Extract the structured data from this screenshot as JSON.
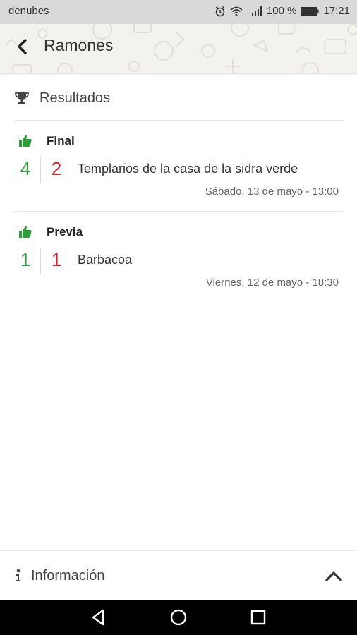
{
  "status_bar": {
    "carrier": "denubes",
    "battery": "100 %",
    "time": "17:21",
    "icons": [
      "alarm-icon",
      "wifi-icon",
      "signal-icon",
      "battery-icon"
    ]
  },
  "header": {
    "title": "Ramones",
    "back_icon": "chevron-left-icon"
  },
  "section": {
    "title": "Resultados",
    "icon": "trophy-icon"
  },
  "matches": [
    {
      "phase": "Final",
      "icon": "thumbs-up-icon",
      "home_score": "4",
      "away_score": "2",
      "opponent": "Templarios de la casa de la sidra verde",
      "date": "Sábado, 13 de mayo - 13:00"
    },
    {
      "phase": "Previa",
      "icon": "thumbs-up-icon",
      "home_score": "1",
      "away_score": "1",
      "opponent": "Barbacoa",
      "date": "Viernes, 12 de mayo - 18:30"
    }
  ],
  "footer": {
    "label": "Información",
    "icon": "info-icon",
    "toggle_icon": "chevron-up-icon"
  },
  "nav": {
    "buttons": [
      "back-triangle-icon",
      "home-circle-icon",
      "recents-square-icon"
    ]
  },
  "colors": {
    "win": "#2e9d3a",
    "loss": "#d2232a",
    "status_bar": "#d9d9d9",
    "header_bg": "#f4f2ef"
  }
}
